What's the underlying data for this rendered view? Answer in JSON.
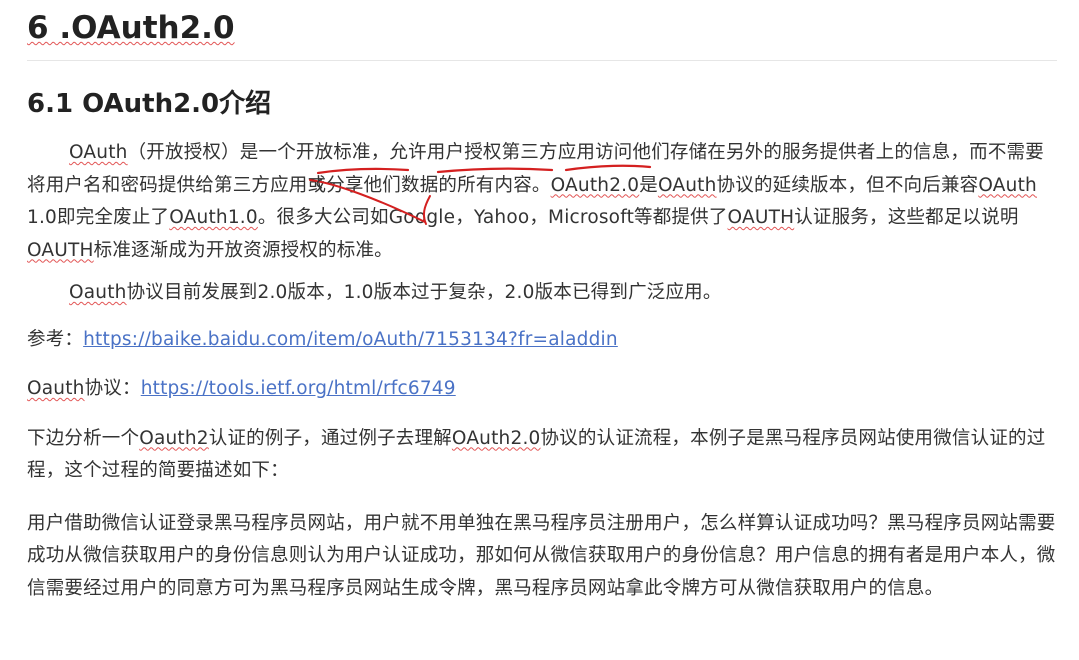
{
  "section": {
    "title": "6 .OAuth2.0"
  },
  "subsection": {
    "title": "6.1 OAuth2.0介绍"
  },
  "paragraph1": {
    "s1": "OAuth",
    "s2": "（开放授权）是一个开放标准，允许用户授权第三方应用访问他们存储在另外的服务提供者上的信息，而不需要将用户名和密码提供给第三方应用或分享他们数据的所有内容。",
    "s3": "OAuth2.0",
    "s4": "是",
    "s5": "OAuth",
    "s6": "协议的延续版本，但不向后兼容",
    "s7": "OAuth",
    "s8": " 1.0即完全废止了",
    "s9": "OAuth1.0",
    "s10": "。很多大公司如Google，Yahoo，Microsoft等都提供了",
    "s11": "OAUTH",
    "s12": "认证服务，这些都足以说明",
    "s13": "OAUTH",
    "s14": "标准逐渐成为开放资源授权的标准。"
  },
  "paragraph2": {
    "s1": "Oauth",
    "s2": "协议目前发展到2.0版本，1.0版本过于复杂，2.0版本已得到广泛应用。"
  },
  "reference": {
    "label": "参考：",
    "link": "https://baike.baidu.com/item/oAuth/7153134?fr=aladdin"
  },
  "protocol": {
    "label_word": "Oauth",
    "label_rest": "协议：",
    "link": "https://tools.ietf.org/html/rfc6749"
  },
  "paragraph3": {
    "s1": "下边分析一个",
    "s2": "Oauth2",
    "s3": "认证的例子，通过例子去理解",
    "s4": "OAuth2.0",
    "s5": "协议的认证流程，本例子是黑马程序员网站使用微信认证的过程，这个过程的简要描述如下："
  },
  "paragraph4": {
    "text": "用户借助微信认证登录黑马程序员网站，用户就不用单独在黑马程序员注册用户，怎么样算认证成功吗？黑马程序员网站需要成功从微信获取用户的身份信息则认为用户认证成功，那如何从微信获取用户的身份信息？用户信息的拥有者是用户本人，微信需要经过用户的同意方可为黑马程序员网站生成令牌，黑马程序员网站拿此令牌方可从微信获取用户的信息。"
  },
  "colors": {
    "link": "#4a72c6",
    "spellcheck": "#e25555",
    "annotation": "#d42020"
  }
}
